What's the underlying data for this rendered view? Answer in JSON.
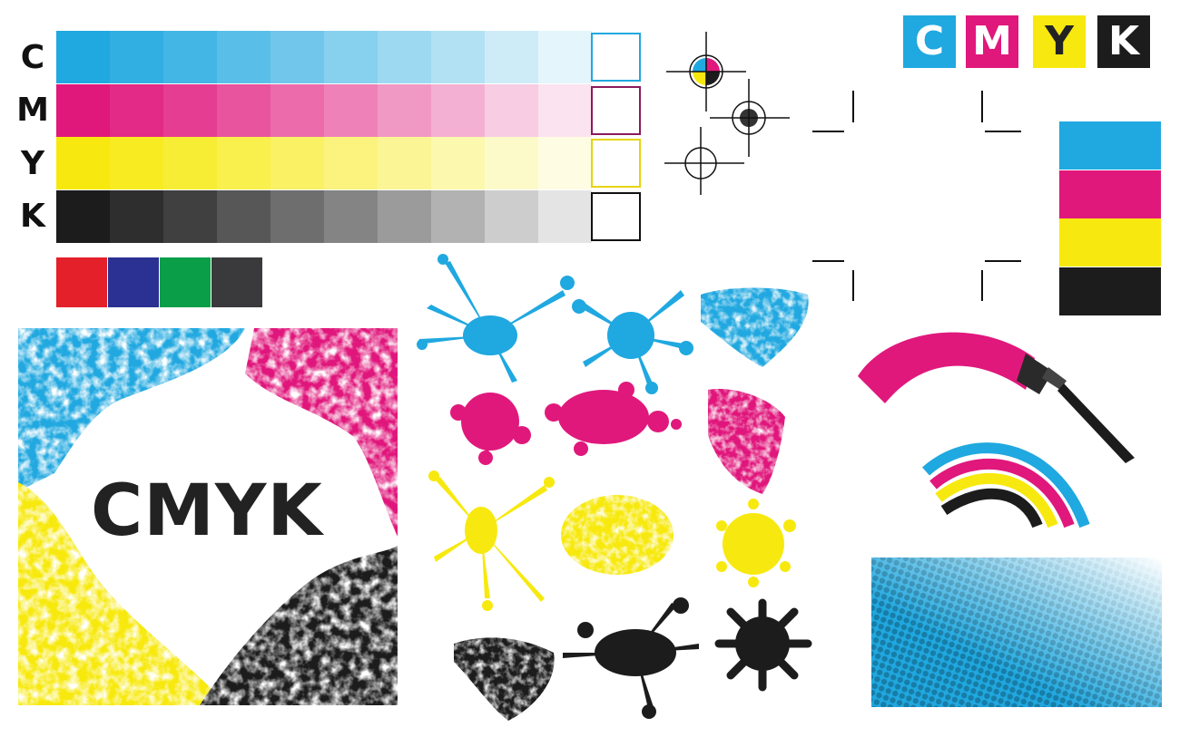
{
  "logo": {
    "letters": [
      "C",
      "M",
      "Y",
      "K"
    ]
  },
  "rows": [
    {
      "label": "C",
      "color": "#20a8e0"
    },
    {
      "label": "M",
      "color": "#e0187c"
    },
    {
      "label": "Y",
      "color": "#f7e90f"
    },
    {
      "label": "K",
      "color": "#1c1c1c"
    }
  ],
  "rgb_swatches": [
    "#e4202a",
    "#2b3192",
    "#0b9e49",
    "#3a3a3c"
  ],
  "main_panel": {
    "title": "CMYK"
  },
  "colors": {
    "cyan": "#20a8e0",
    "magenta": "#e0187c",
    "yellow": "#f7e90f",
    "black": "#1c1c1c"
  }
}
